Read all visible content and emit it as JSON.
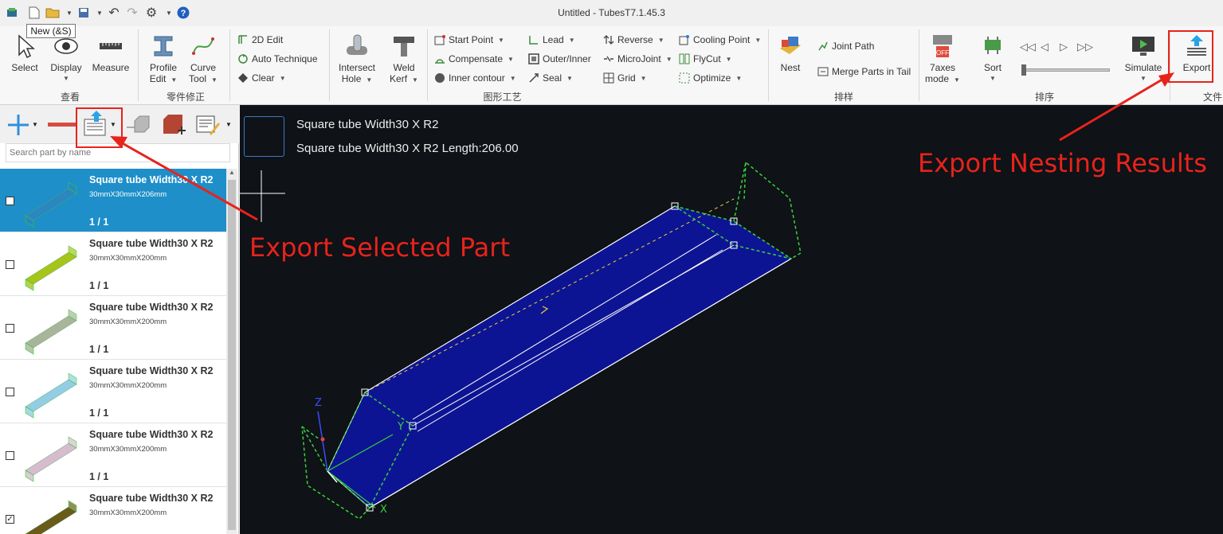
{
  "window": {
    "title": "Untitled - TubesT7.1.45.3"
  },
  "tooltip": "New (&S)",
  "quick_access": [
    "app-icon",
    "new-file-icon",
    "open-folder-icon",
    "save-icon",
    "undo-icon",
    "redo-icon",
    "settings-gear-icon",
    "help-icon"
  ],
  "ribbon": {
    "groups": {
      "view": "查看",
      "part_edit": "零件修正",
      "graphics": "图形工艺",
      "nesting": "排样",
      "sort": "排序",
      "file": "文件"
    },
    "select": "Select",
    "display": "Display",
    "measure": "Measure",
    "profile_edit": [
      "Profile",
      "Edit"
    ],
    "curve_tool": [
      "Curve",
      "Tool"
    ],
    "edit_2d": "2D Edit",
    "auto_technique": "Auto Technique",
    "clear": "Clear",
    "intersect_hole": [
      "Intersect",
      "Hole"
    ],
    "weld_kerf": [
      "Weld",
      "Kerf"
    ],
    "start_point": "Start Point",
    "compensate": "Compensate",
    "inner_contour": "Inner contour",
    "lead": "Lead",
    "outer_inner": "Outer/Inner",
    "seal": "Seal",
    "reverse": "Reverse",
    "microjoint": "MicroJoint",
    "grid": "Grid",
    "cooling_point": "Cooling Point",
    "flycut": "FlyCut",
    "optimize": "Optimize",
    "nest": "Nest",
    "joint_path": "Joint Path",
    "merge_parts": "Merge Parts in Tail",
    "axes_mode": [
      "7axes",
      "mode"
    ],
    "axes_badge": "OFF",
    "sort": "Sort",
    "simulate": "Simulate",
    "export": "Export"
  },
  "left_panel": {
    "search_placeholder": "Search part by name",
    "parts": [
      {
        "name": "Square tube Width30 X R2",
        "dims": "30mmX30mmX206mm",
        "count": "1 / 1",
        "color": "#2a87c0",
        "selected": true,
        "checked": false
      },
      {
        "name": "Square tube Width30 X R2",
        "dims": "30mmX30mmX200mm",
        "count": "1 / 1",
        "color": "#a7c41a",
        "selected": false,
        "checked": false
      },
      {
        "name": "Square tube Width30 X R2",
        "dims": "30mmX30mmX200mm",
        "count": "1 / 1",
        "color": "#a9b59a",
        "selected": false,
        "checked": false
      },
      {
        "name": "Square tube Width30 X R2",
        "dims": "30mmX30mmX200mm",
        "count": "1 / 1",
        "color": "#93cde3",
        "selected": false,
        "checked": false
      },
      {
        "name": "Square tube Width30 X R2",
        "dims": "30mmX30mmX200mm",
        "count": "1 / 1",
        "color": "#d7bcce",
        "selected": false,
        "checked": false
      },
      {
        "name": "Square tube Width30 X R2",
        "dims": "30mmX30mmX200mm",
        "count": "",
        "color": "#6b5a1a",
        "selected": false,
        "checked": true
      }
    ]
  },
  "canvas": {
    "info_line1": "Square tube Width30 X R2",
    "info_line2": "Square tube Width30 X R2 Length:206.00",
    "axis_labels": {
      "x": "X",
      "y": "Y",
      "z": "Z"
    }
  },
  "annotations": {
    "export_selected": "Export Selected Part",
    "export_nesting": "Export Nesting Results"
  },
  "colors": {
    "accent_red": "#e8231b",
    "selection_blue": "#1e8fc8",
    "canvas_bg": "#0f1217",
    "tube_fill": "#0d1493",
    "path_green": "#38d13a"
  }
}
